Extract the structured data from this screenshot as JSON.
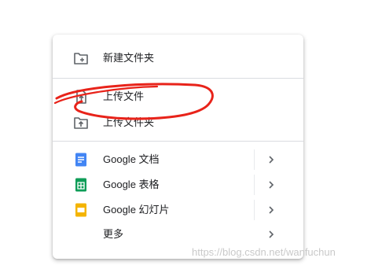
{
  "menu": {
    "items": [
      {
        "icon": "folder-plus-icon",
        "label": "新建文件夹",
        "has_submenu": false
      },
      {
        "icon": "file-upload-icon",
        "label": "上传文件",
        "has_submenu": false
      },
      {
        "icon": "folder-upload-icon",
        "label": "上传文件夹",
        "has_submenu": false
      },
      {
        "icon": "google-docs-icon",
        "label": "Google 文档",
        "has_submenu": true
      },
      {
        "icon": "google-sheets-icon",
        "label": "Google 表格",
        "has_submenu": true
      },
      {
        "icon": "google-slides-icon",
        "label": "Google 幻灯片",
        "has_submenu": true
      },
      {
        "icon": "more-icon",
        "label": "更多",
        "has_submenu": true
      }
    ]
  },
  "watermark": "https://blog.csdn.net/wanfuchun",
  "colors": {
    "docs_blue": "#4285f4",
    "sheets_green": "#0f9d58",
    "slides_yellow": "#f4b400",
    "icon_gray": "#5f6368",
    "annotation_red": "#e8231a"
  }
}
